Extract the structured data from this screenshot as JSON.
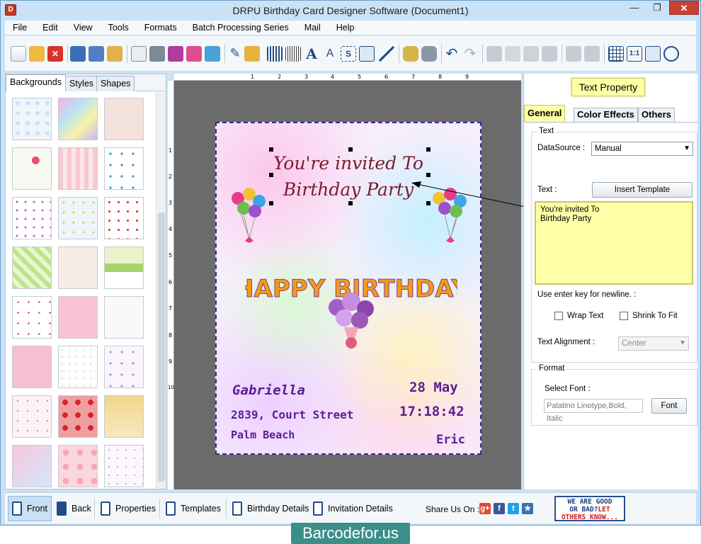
{
  "window": {
    "title": "DRPU Birthday Card Designer Software (Document1)"
  },
  "menu": [
    "File",
    "Edit",
    "View",
    "Tools",
    "Formats",
    "Batch Processing Series",
    "Mail",
    "Help"
  ],
  "left_panel": {
    "tabs": [
      "Backgrounds",
      "Styles",
      "Shapes"
    ],
    "active_tab": "Backgrounds",
    "thumbnail_count": 24
  },
  "ruler": {
    "top_marks": [
      "1",
      "2",
      "3",
      "4",
      "5",
      "6",
      "7",
      "8",
      "9"
    ],
    "left_marks": [
      "1",
      "2",
      "3",
      "4",
      "5",
      "6",
      "7",
      "8",
      "9",
      "10"
    ]
  },
  "card": {
    "title_line1": "You're invited To",
    "title_line2": "Birthday Party",
    "banner": "HAPPY BIRTHDAY",
    "name": "Gabriella",
    "street": "2839, Court Street",
    "city": "Palm Beach",
    "date": "28 May",
    "time": "17:18:42",
    "signer": "Eric"
  },
  "right_panel": {
    "header": "Text Property",
    "tabs": [
      "General",
      "Color Effects",
      "Others"
    ],
    "active_tab": "General",
    "text_group_title": "Text",
    "datasource_label": "DataSource :",
    "datasource_value": "Manual",
    "text_label": "Text :",
    "insert_template_label": "Insert Template",
    "text_value": "You're invited To\n Birthday Party",
    "newline_hint": "Use enter key for newline. :",
    "wrap_text_label": "Wrap Text",
    "shrink_to_fit_label": "Shrink To Fit",
    "alignment_label": "Text Alignment :",
    "alignment_value": "Center",
    "format_group_title": "Format",
    "select_font_label": "Select Font :",
    "font_value": "Palatino Linotype,Bold, Italic",
    "font_button_label": "Font"
  },
  "bottom_bar": {
    "front_label": "Front",
    "back_label": "Back",
    "properties_label": "Properties",
    "templates_label": "Templates",
    "birthday_details_label": "Birthday Details",
    "invitation_details_label": "Invitation Details",
    "share_label": "Share Us On :",
    "feedback_line1": "WE ARE GOOD",
    "feedback_line2a": "OR BAD?",
    "feedback_line2b": "LET",
    "feedback_line3": "OTHERS KNOW..."
  },
  "watermark": "Barcodefor.us",
  "colors": {
    "title_text": "#7a1b2e",
    "card_text": "#5a1e96",
    "highlight": "#ffffa6",
    "canvas_bg": "#6b6b6b"
  }
}
